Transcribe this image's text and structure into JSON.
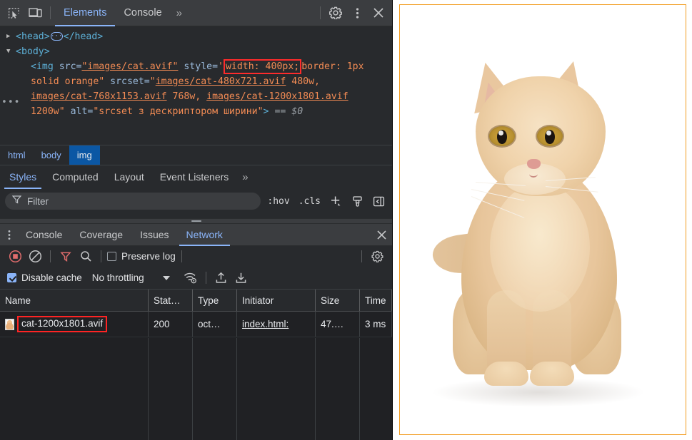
{
  "devtools": {
    "toolbar": {
      "inspect_icon": "inspect-element-icon",
      "device_icon": "device-toolbar-icon",
      "tabs": [
        {
          "label": "Elements",
          "active": true
        },
        {
          "label": "Console",
          "active": false
        }
      ],
      "more_tabs": "»",
      "settings_icon": "gear-icon",
      "menu_icon": "kebab-menu-icon",
      "close_icon": "close-icon"
    },
    "dom": {
      "line_head": {
        "tag_open": "<head>",
        "tag_close": "</head>",
        "collapsed_badge": "···",
        "arrow": "▶"
      },
      "line_body": {
        "tag_open": "<body>",
        "arrow": "▼"
      },
      "img_node": {
        "open": "<img ",
        "attr_src_name": "src=",
        "attr_src_value": "\"images/cat.avif\"",
        "attr_style_name": " style=",
        "style_quote_open": "'",
        "style_highlight": "width: 400px;",
        "style_rest": "border: 1px solid orange\"",
        "attr_srcset_name": " srcset=",
        "srcset_open_quote": "\"",
        "srcset_1": "images/cat-480x721.avif",
        "srcset_1_w": " 480w, ",
        "srcset_2": "images/cat-768x1153.avif",
        "srcset_2_w": " 768w, ",
        "srcset_3": "images/cat-1200x1801.avif",
        "srcset_3_w": " 1200w\"",
        "attr_alt_name": " alt=",
        "attr_alt_value": "\"srcset з дескриптором ширини\"",
        "close_bracket": ">",
        "eqeq": "==",
        "selected_ref": "$0",
        "overflow_marker": "•••"
      }
    },
    "breadcrumb": [
      {
        "label": "html",
        "selected": false
      },
      {
        "label": "body",
        "selected": false
      },
      {
        "label": "img",
        "selected": true
      }
    ],
    "styles_tabs": [
      {
        "label": "Styles",
        "active": true
      },
      {
        "label": "Computed",
        "active": false
      },
      {
        "label": "Layout",
        "active": false
      },
      {
        "label": "Event Listeners",
        "active": false
      }
    ],
    "styles_more": "»",
    "styles_filter": {
      "placeholder": "Filter",
      "filter_icon": "funnel-icon",
      "hov_label": ":hov",
      "cls_label": ".cls",
      "new_rule_icon": "plus-icon",
      "class_icon": "paintbrush-icon",
      "sidebar_icon": "toggle-sidebar-icon"
    }
  },
  "drawer": {
    "menu_icon": "kebab-menu-icon",
    "tabs": [
      {
        "label": "Console",
        "active": false
      },
      {
        "label": "Coverage",
        "active": false
      },
      {
        "label": "Issues",
        "active": false
      },
      {
        "label": "Network",
        "active": true
      }
    ],
    "close_icon": "close-icon",
    "toolbar": {
      "record_icon": "record-stop-icon",
      "clear_icon": "clear-icon",
      "filter_icon": "funnel-icon",
      "search_icon": "search-icon",
      "preserve_log_label": "Preserve log",
      "preserve_log_checked": false,
      "settings_icon": "gear-icon",
      "disable_cache_label": "Disable cache",
      "disable_cache_checked": true,
      "throttling_value": "No throttling",
      "throttling_caret": "dropdown-caret-icon",
      "network_conditions_icon": "wifi-settings-icon",
      "import_har_icon": "upload-icon",
      "export_har_icon": "download-icon"
    },
    "table": {
      "columns": [
        "Name",
        "Stat…",
        "Type",
        "Initiator",
        "Size",
        "Time"
      ],
      "rows": [
        {
          "name": "cat-1200x1801.avif",
          "status": "200",
          "type": "oct…",
          "initiator": "index.html:",
          "size": "47.…",
          "time": "3 ms",
          "highlighted": true
        }
      ]
    }
  },
  "page_preview": {
    "alt": "srcset з дескриптором ширини",
    "border_color": "#f29c1f",
    "subject": "orange-kitten-photo"
  },
  "colors": {
    "accent_blue": "#8ab4f8",
    "highlight_red": "#ff2424",
    "image_border_orange": "#f29c1f",
    "panel_bg": "#282a2d",
    "toolbar_bg": "#3b3d40",
    "crumb_selected_bg": "#0b57a4"
  }
}
